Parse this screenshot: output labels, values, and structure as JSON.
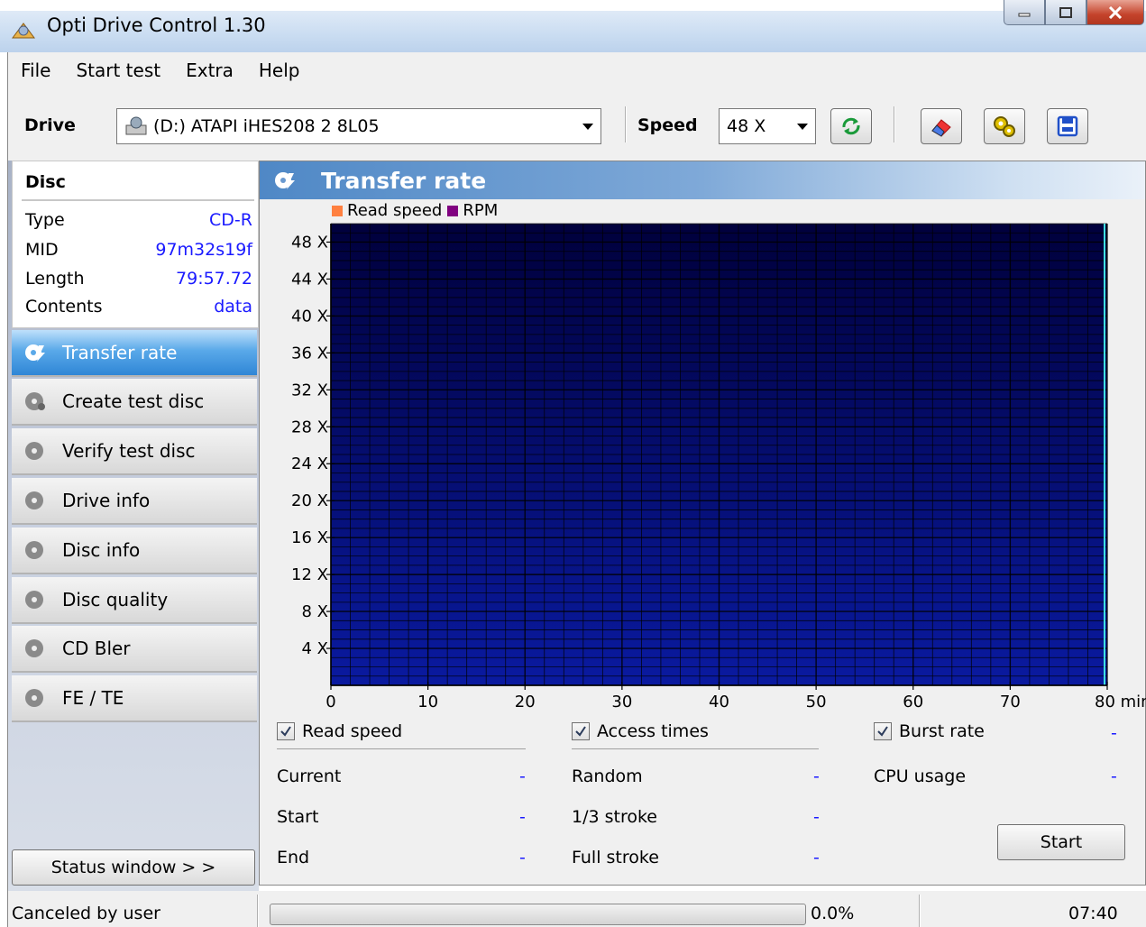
{
  "window": {
    "title": "Opti Drive Control 1.30"
  },
  "menu": [
    "File",
    "Start test",
    "Extra",
    "Help"
  ],
  "toolbar": {
    "drive_label": "Drive",
    "drive_value": "(D:)  ATAPI iHES208   2 8L05",
    "speed_label": "Speed",
    "speed_value": "48 X"
  },
  "disc": {
    "header": "Disc",
    "rows": [
      {
        "label": "Type",
        "value": "CD-R"
      },
      {
        "label": "MID",
        "value": "97m32s19f"
      },
      {
        "label": "Length",
        "value": "79:57.72"
      },
      {
        "label": "Contents",
        "value": "data"
      }
    ]
  },
  "nav": [
    {
      "label": "Transfer rate",
      "active": true
    },
    {
      "label": "Create test disc"
    },
    {
      "label": "Verify test disc"
    },
    {
      "label": "Drive info"
    },
    {
      "label": "Disc info"
    },
    {
      "label": "Disc quality"
    },
    {
      "label": "CD Bler"
    },
    {
      "label": "FE / TE"
    }
  ],
  "status_window_button": "Status window > >",
  "panel": {
    "title": "Transfer rate"
  },
  "chart_data": {
    "type": "line",
    "title": "",
    "legend": [
      "Read speed",
      "RPM"
    ],
    "legend_colors": [
      "#ff8040",
      "#800080"
    ],
    "x_ticks": [
      "0",
      "10",
      "20",
      "30",
      "40",
      "50",
      "60",
      "70",
      "80 min"
    ],
    "y_ticks": [
      "4 X",
      "8 X",
      "12 X",
      "16 X",
      "20 X",
      "24 X",
      "28 X",
      "32 X",
      "36 X",
      "40 X",
      "44 X",
      "48 X"
    ],
    "xlim": [
      0,
      80
    ],
    "ylim": [
      0,
      50
    ],
    "x_unit": "min",
    "y_unit": "X",
    "series": [],
    "grid": true,
    "legend_position": "top-left",
    "background": "#000040"
  },
  "stats": {
    "read_speed_check": "Read speed",
    "access_times_check": "Access times",
    "burst_rate_check": "Burst rate",
    "burst_rate_value": "-",
    "current_label": "Current",
    "current_value": "-",
    "start_label": "Start",
    "start_value": "-",
    "end_label": "End",
    "end_value": "-",
    "random_label": "Random",
    "random_value": "-",
    "third_label": "1/3 stroke",
    "third_value": "-",
    "full_label": "Full stroke",
    "full_value": "-",
    "cpu_label": "CPU usage",
    "cpu_value": "-",
    "start_button": "Start"
  },
  "statusbar": {
    "message": "Canceled by user",
    "progress_text": "0.0%",
    "progress": 0.0,
    "time": "07:40"
  }
}
